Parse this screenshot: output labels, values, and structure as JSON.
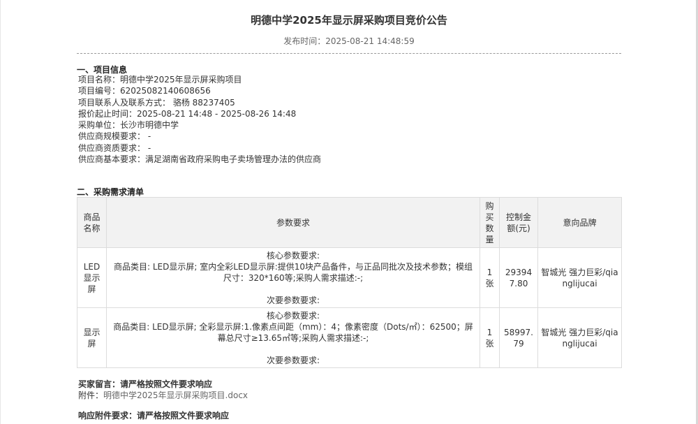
{
  "title": "明德中学2025年显示屏采购项目竞价公告",
  "publish_time": "发布时间：2025-08-21 14:48:59",
  "section1": {
    "heading": "一、项目信息",
    "rows": [
      "项目名称：明德中学2025年显示屏采购项目",
      "项目编号：62025082140608656",
      "项目联系人及联系方式： 骆杨  88237405",
      "报价起止时间：2025-08-21 14:48  -  2025-08-26 14:48",
      "采购单位：长沙市明德中学",
      "供应商规模要求： -",
      "供应商资质要求： -",
      "供应商基本要求：满足湖南省政府采购电子卖场管理办法的供应商"
    ]
  },
  "section2": {
    "heading": "二、采购需求清单",
    "headers": {
      "name": "商品名称",
      "params": "参数要求",
      "qty": "购买数量",
      "price": "控制金额(元)",
      "brand": "意向品牌"
    },
    "items": [
      {
        "name": "LED显示屏",
        "core_label": "核心参数要求:",
        "core_text": "商品类目: LED显示屏; 室内全彩LED显示屏:提供10块产品备件，与正品同批次及技术参数；模组尺寸：320*160等;采购人需求描述:-;",
        "secondary_label": "次要参数要求:",
        "qty": "1张",
        "price": "293947.80",
        "brand": "智城光 强力巨彩/qianglijucai"
      },
      {
        "name": "显示屏",
        "core_label": "核心参数要求:",
        "core_text": "商品类目: LED显示屏; 全彩显示屏:1.像素点间距（mm）：4；像素密度（Dots/㎡）：62500；屏幕总尺寸≥13.65㎡等;采购人需求描述:-;",
        "secondary_label": "次要参数要求:",
        "qty": "1张",
        "price": "58997.79",
        "brand": "智城光 强力巨彩/qianglijucai"
      }
    ]
  },
  "footer": {
    "message_label": "买家留言：",
    "message": "请严格按照文件要求响应",
    "attachment_label": "附件：",
    "attachment": "明德中学2025年显示屏采购项目.docx",
    "response_label": "响应附件要求：",
    "response": "请严格按照文件要求响应"
  }
}
